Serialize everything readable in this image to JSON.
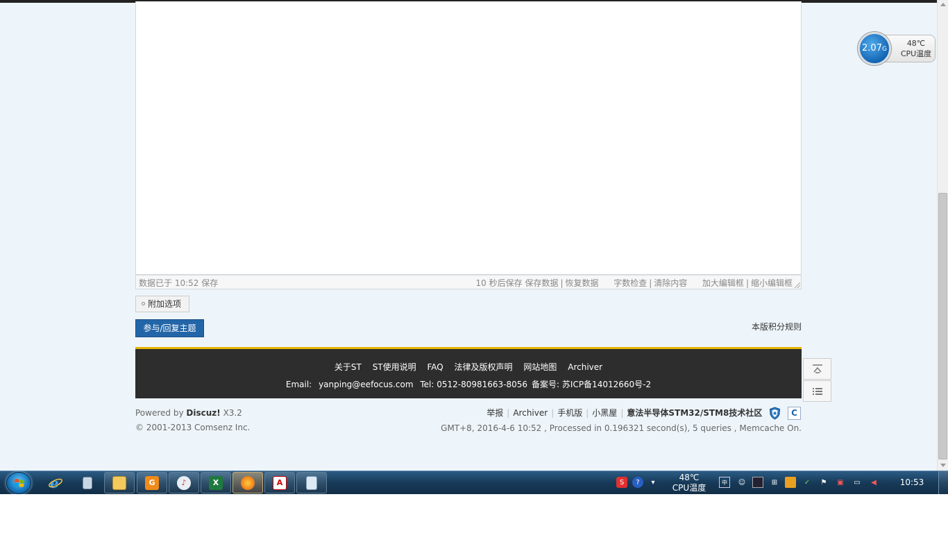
{
  "editor": {
    "saved_status": "数据已于 10:52 保存",
    "autosave": "10 秒后保存",
    "save_data": "保存数据",
    "restore_data": "恢复数据",
    "word_check": "字数检查",
    "clear_content": "清除内容",
    "enlarge": "加大编辑框",
    "shrink": "缩小编辑框"
  },
  "post": {
    "attach_options": "附加选项",
    "reply_button": "参与/回复主题",
    "rules_link": "本版积分规则"
  },
  "footer": {
    "links": [
      "关于ST",
      "ST使用说明",
      "FAQ",
      "法律及版权声明",
      "网站地图",
      "Archiver"
    ],
    "email_label": "Email:",
    "email": "yanping@eefocus.com",
    "tel": "Tel: 0512-80981663-8056",
    "icp": "备案号: 苏ICP备14012660号-2",
    "powered_prefix": "Powered by",
    "powered_brand": "Discuz!",
    "powered_version": "X3.2",
    "copyright": "© 2001-2013 Comsenz Inc.",
    "nav": [
      "举报",
      "Archiver",
      "手机版",
      "小黑屋"
    ],
    "community": "意法半导体STM32/STM8技术社区",
    "gmt": "GMT+8, 2016-4-6 10:52 , Processed in 0.196321 second(s), 5 queries , Memcache On."
  },
  "cpu_widget": {
    "freq": "2.07",
    "freq_unit": "G",
    "temp": "48℃",
    "label": "CPU温度"
  },
  "taskbar": {
    "temp": "48℃",
    "temp_label": "CPU温度",
    "clock": "10:53",
    "icons": [
      "ie-icon",
      "calculator-icon",
      "explorer-icon",
      "app-g-icon",
      "media-icon",
      "excel-icon",
      "firefox-icon",
      "pdf-icon",
      "notepad-icon"
    ]
  },
  "colors": {
    "page_bg": "#eef5fa",
    "footer_bg": "#2d2d2d",
    "footer_accent": "#e6b300",
    "reply_btn": "#2366a8"
  }
}
